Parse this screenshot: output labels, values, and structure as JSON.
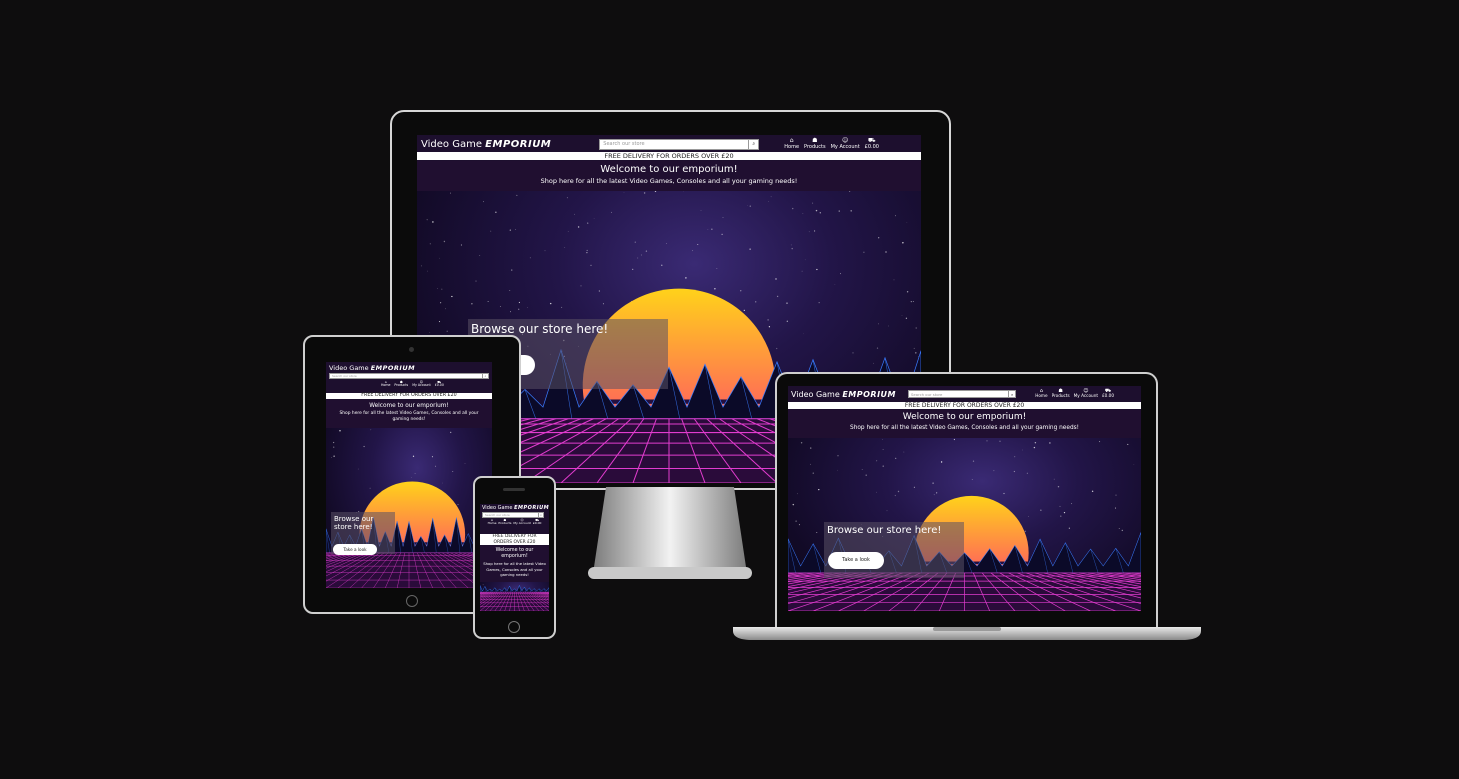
{
  "site": {
    "logo_text": "Video Game",
    "logo_bold": "EMPORIUM",
    "search_placeholder": "Search our store",
    "nav": {
      "home": "Home",
      "products": "Products",
      "account": "My Account",
      "cart": "£0.00"
    },
    "delivery": "FREE DELIVERY FOR ORDERS OVER £20",
    "welcome_title": "Welcome to our emporium!",
    "welcome_sub": "Shop here for all the latest Video Games, Consoles and all your gaming needs!",
    "browse": "Browse our store here!",
    "cta": "Take a look"
  },
  "icons": {
    "home": "home-icon",
    "products": "products-icon",
    "account": "user-icon",
    "cart": "cart-icon",
    "search": "search-icon"
  },
  "colors": {
    "background": "#0e0d0e",
    "nav": "#1d0f2e",
    "sun_top": "#ffd21a",
    "sun_bottom": "#ff2a7d",
    "grid": "#e23ccf",
    "mountains": "#3a7bff"
  }
}
